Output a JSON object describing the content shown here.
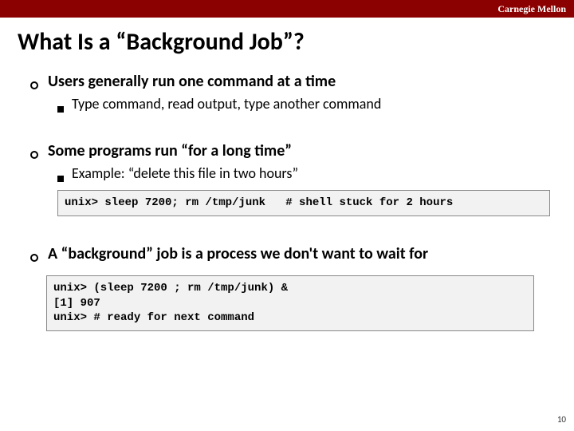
{
  "header": {
    "brand": "Carnegie Mellon"
  },
  "title": "What Is a “Background Job”?",
  "points": [
    {
      "text": "Users generally run one command at a time",
      "sub": [
        {
          "text": "Type command, read output, type another command"
        }
      ]
    },
    {
      "text": "Some programs run “for a long time”",
      "sub": [
        {
          "text": "Example: “delete this file in two hours”"
        }
      ],
      "code": "unix> sleep 7200; rm /tmp/junk   # shell stuck for 2 hours"
    },
    {
      "text": "A “background” job is a process we don't want to wait for",
      "code": "unix> (sleep 7200 ; rm /tmp/junk) &\n[1] 907\nunix> # ready for next command"
    }
  ],
  "page_number": "10"
}
